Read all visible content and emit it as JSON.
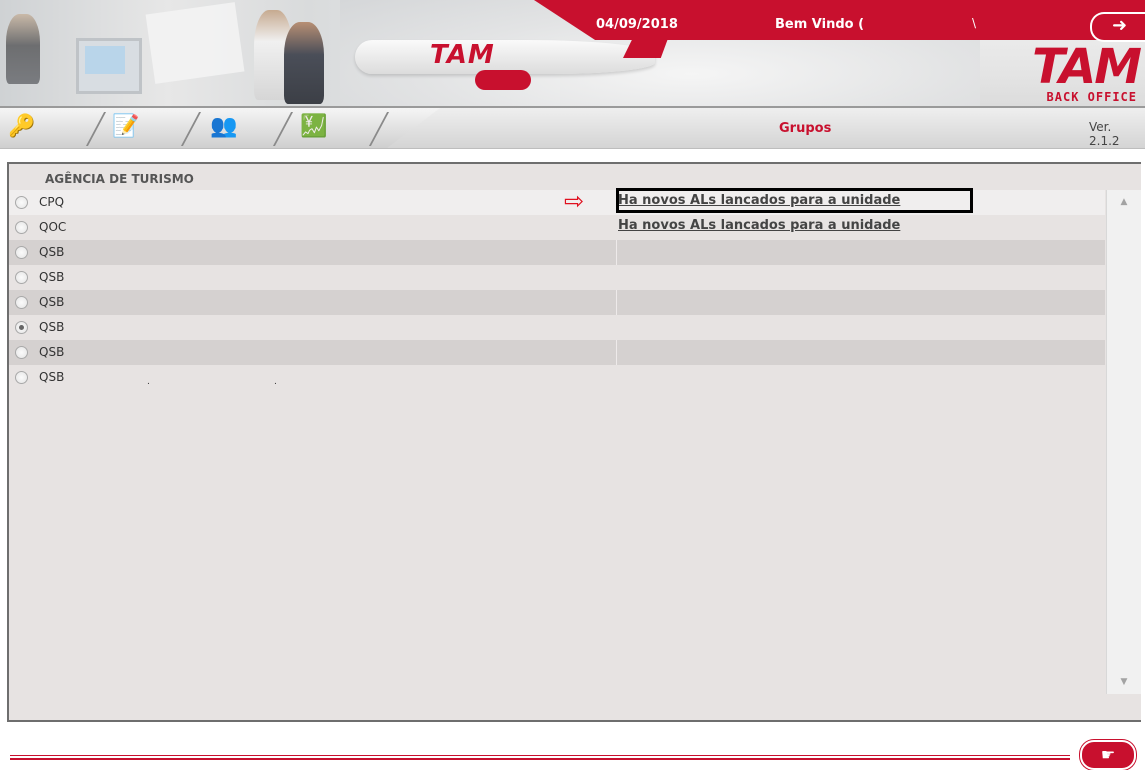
{
  "header": {
    "date": "04/09/2018",
    "welcome": "Bem Vindo (",
    "welcome_mark": "\\",
    "logo_main": "TAM",
    "logo_sub": "BACK OFFICE",
    "plane_logo": "TAM"
  },
  "toolbar": {
    "title": "Grupos",
    "version": "Ver. 2.1.2",
    "icons": [
      "keys-icon",
      "form-edit-icon",
      "people-icon",
      "finance-chart-icon"
    ]
  },
  "section": {
    "title": "AGÊNCIA DE TURISMO"
  },
  "rows": [
    {
      "code": "CPQ",
      "message": "Ha novos ALs lancados para a unidade",
      "checked": false
    },
    {
      "code": "QOC",
      "message": "Ha novos ALs lancados para a unidade",
      "checked": false
    },
    {
      "code": "QSB",
      "message": "",
      "checked": false
    },
    {
      "code": "QSB",
      "message": "",
      "checked": false
    },
    {
      "code": "QSB",
      "message": "",
      "checked": false
    },
    {
      "code": "QSB",
      "message": "",
      "checked": true
    },
    {
      "code": "QSB",
      "message": "",
      "checked": false
    },
    {
      "code": "QSB",
      "message": "",
      "checked": false
    }
  ],
  "annotation": {
    "arrow": "⇨"
  },
  "colors": {
    "brand_red": "#c8102e",
    "panel_bg": "#e7e3e2",
    "row_alt": "#d5d1d0"
  }
}
